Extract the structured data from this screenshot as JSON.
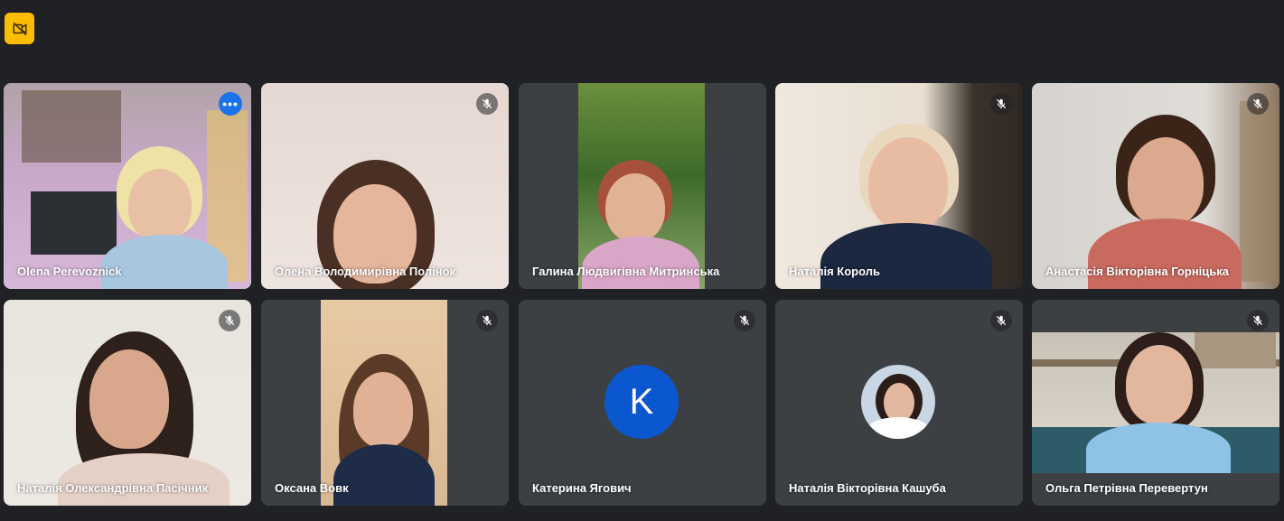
{
  "toolbar": {
    "badge_icon": "no-video-icon",
    "badge_color": "#fbbc04"
  },
  "participants": [
    {
      "name": "Olena Perevoznick",
      "muted": false,
      "active": true
    },
    {
      "name": "Олена Володимирівна Полінок",
      "muted": true
    },
    {
      "name": "Галина Людвигівна Митринська",
      "muted": false
    },
    {
      "name": "Наталія Король",
      "muted": true
    },
    {
      "name": "Анастасія Вікторівна Горніцька",
      "muted": true
    },
    {
      "name": "Наталія Олександрівна Пасічник",
      "muted": true
    },
    {
      "name": "Оксана Вовк",
      "muted": true
    },
    {
      "name": "Катерина Ягович",
      "muted": true,
      "avatar_letter": "K",
      "avatar_color": "#0b57d0"
    },
    {
      "name": "Наталія Вікторівна Кашуба",
      "muted": true
    },
    {
      "name": "Ольга Петрівна Перевертун",
      "muted": true
    }
  ],
  "more_options_label": "•••",
  "colors": {
    "background": "#202124",
    "tile": "#3c4043",
    "active_outline": "#8ab4f8",
    "more_button": "#1a73e8"
  }
}
